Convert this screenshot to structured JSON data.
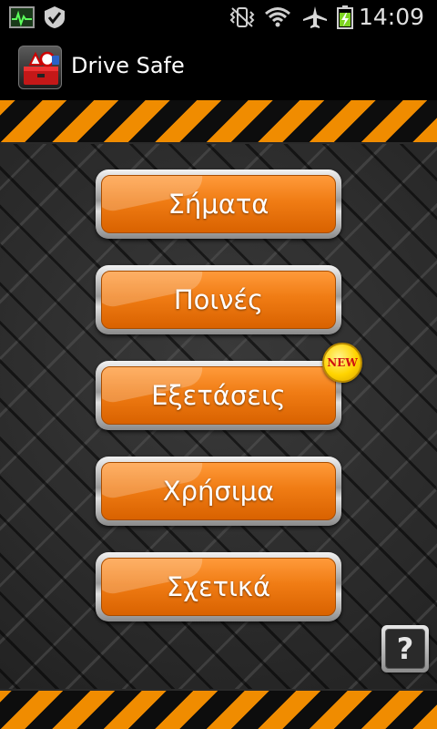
{
  "status_bar": {
    "time": "14:09",
    "icons": [
      "system-monitor-icon",
      "check-icon",
      "vibrate-icon",
      "wifi-icon",
      "airplane-mode-icon",
      "battery-charging-icon"
    ]
  },
  "action_bar": {
    "title": "Drive Safe",
    "icon": "app-toolbox-icon"
  },
  "menu": {
    "items": [
      {
        "label": "Σήματα"
      },
      {
        "label": "Ποινές"
      },
      {
        "label": "Εξετάσεις",
        "badge": "NEW"
      },
      {
        "label": "Χρήσιμα"
      },
      {
        "label": "Σχετικά"
      }
    ]
  },
  "help": {
    "label": "?"
  },
  "colors": {
    "accent_orange": "#f07c14",
    "stripe_orange": "#f08c00",
    "stripe_black": "#0d0d0d",
    "badge_yellow": "#ffd400",
    "badge_text_red": "#d0100f"
  }
}
